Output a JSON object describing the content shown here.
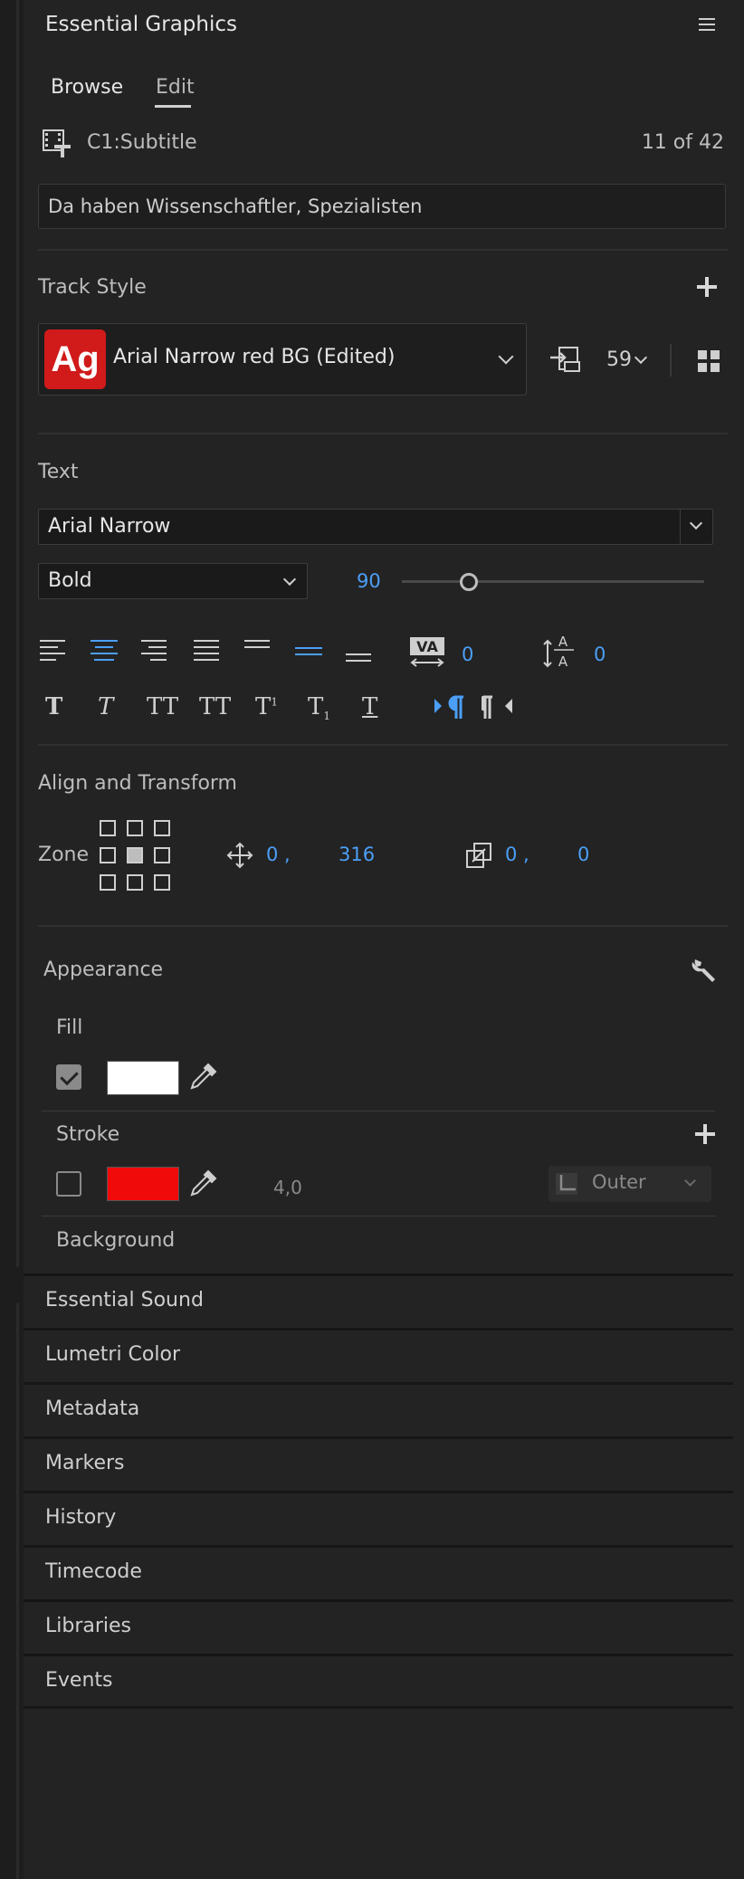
{
  "header": {
    "title": "Essential Graphics"
  },
  "tabs": [
    {
      "label": "Browse"
    },
    {
      "label": "Edit"
    }
  ],
  "clip": {
    "name": "C1:Subtitle",
    "position": "11 of 42"
  },
  "caption_text": "Da haben Wissenschaftler, Spezialisten",
  "track_style": {
    "label": "Track Style",
    "thumb_text": "Ag",
    "style_name": "Arial Narrow red BG (Edited)",
    "count": "59",
    "accent_color": "#d11a1a"
  },
  "text": {
    "label": "Text",
    "font": "Arial Narrow",
    "weight": "Bold",
    "size": "90",
    "size_fraction": 0.24,
    "kerning": "0",
    "leading": "0",
    "style_buttons": [
      "T",
      "T",
      "TT",
      "TT",
      "T",
      "T",
      "T"
    ]
  },
  "align_transform": {
    "label": "Align and Transform",
    "zone_label": "Zone",
    "position_x": "0 ,",
    "position_y": "316",
    "scale_x": "0 ,",
    "scale_y": "0"
  },
  "appearance": {
    "label": "Appearance",
    "fill": {
      "label": "Fill",
      "checked": true,
      "color": "#ffffff"
    },
    "stroke": {
      "label": "Stroke",
      "checked": false,
      "color": "#f00a0a",
      "width": "4,0",
      "mode": "Outer"
    },
    "background": {
      "label": "Background"
    }
  },
  "collapsed_panels": [
    {
      "label": "Essential Sound"
    },
    {
      "label": "Lumetri Color"
    },
    {
      "label": "Metadata"
    },
    {
      "label": "Markers"
    },
    {
      "label": "History"
    },
    {
      "label": "Timecode"
    },
    {
      "label": "Libraries"
    },
    {
      "label": "Events"
    }
  ],
  "colors": {
    "highlight_blue": "#4b9ff7",
    "panel_bg": "#232323"
  }
}
